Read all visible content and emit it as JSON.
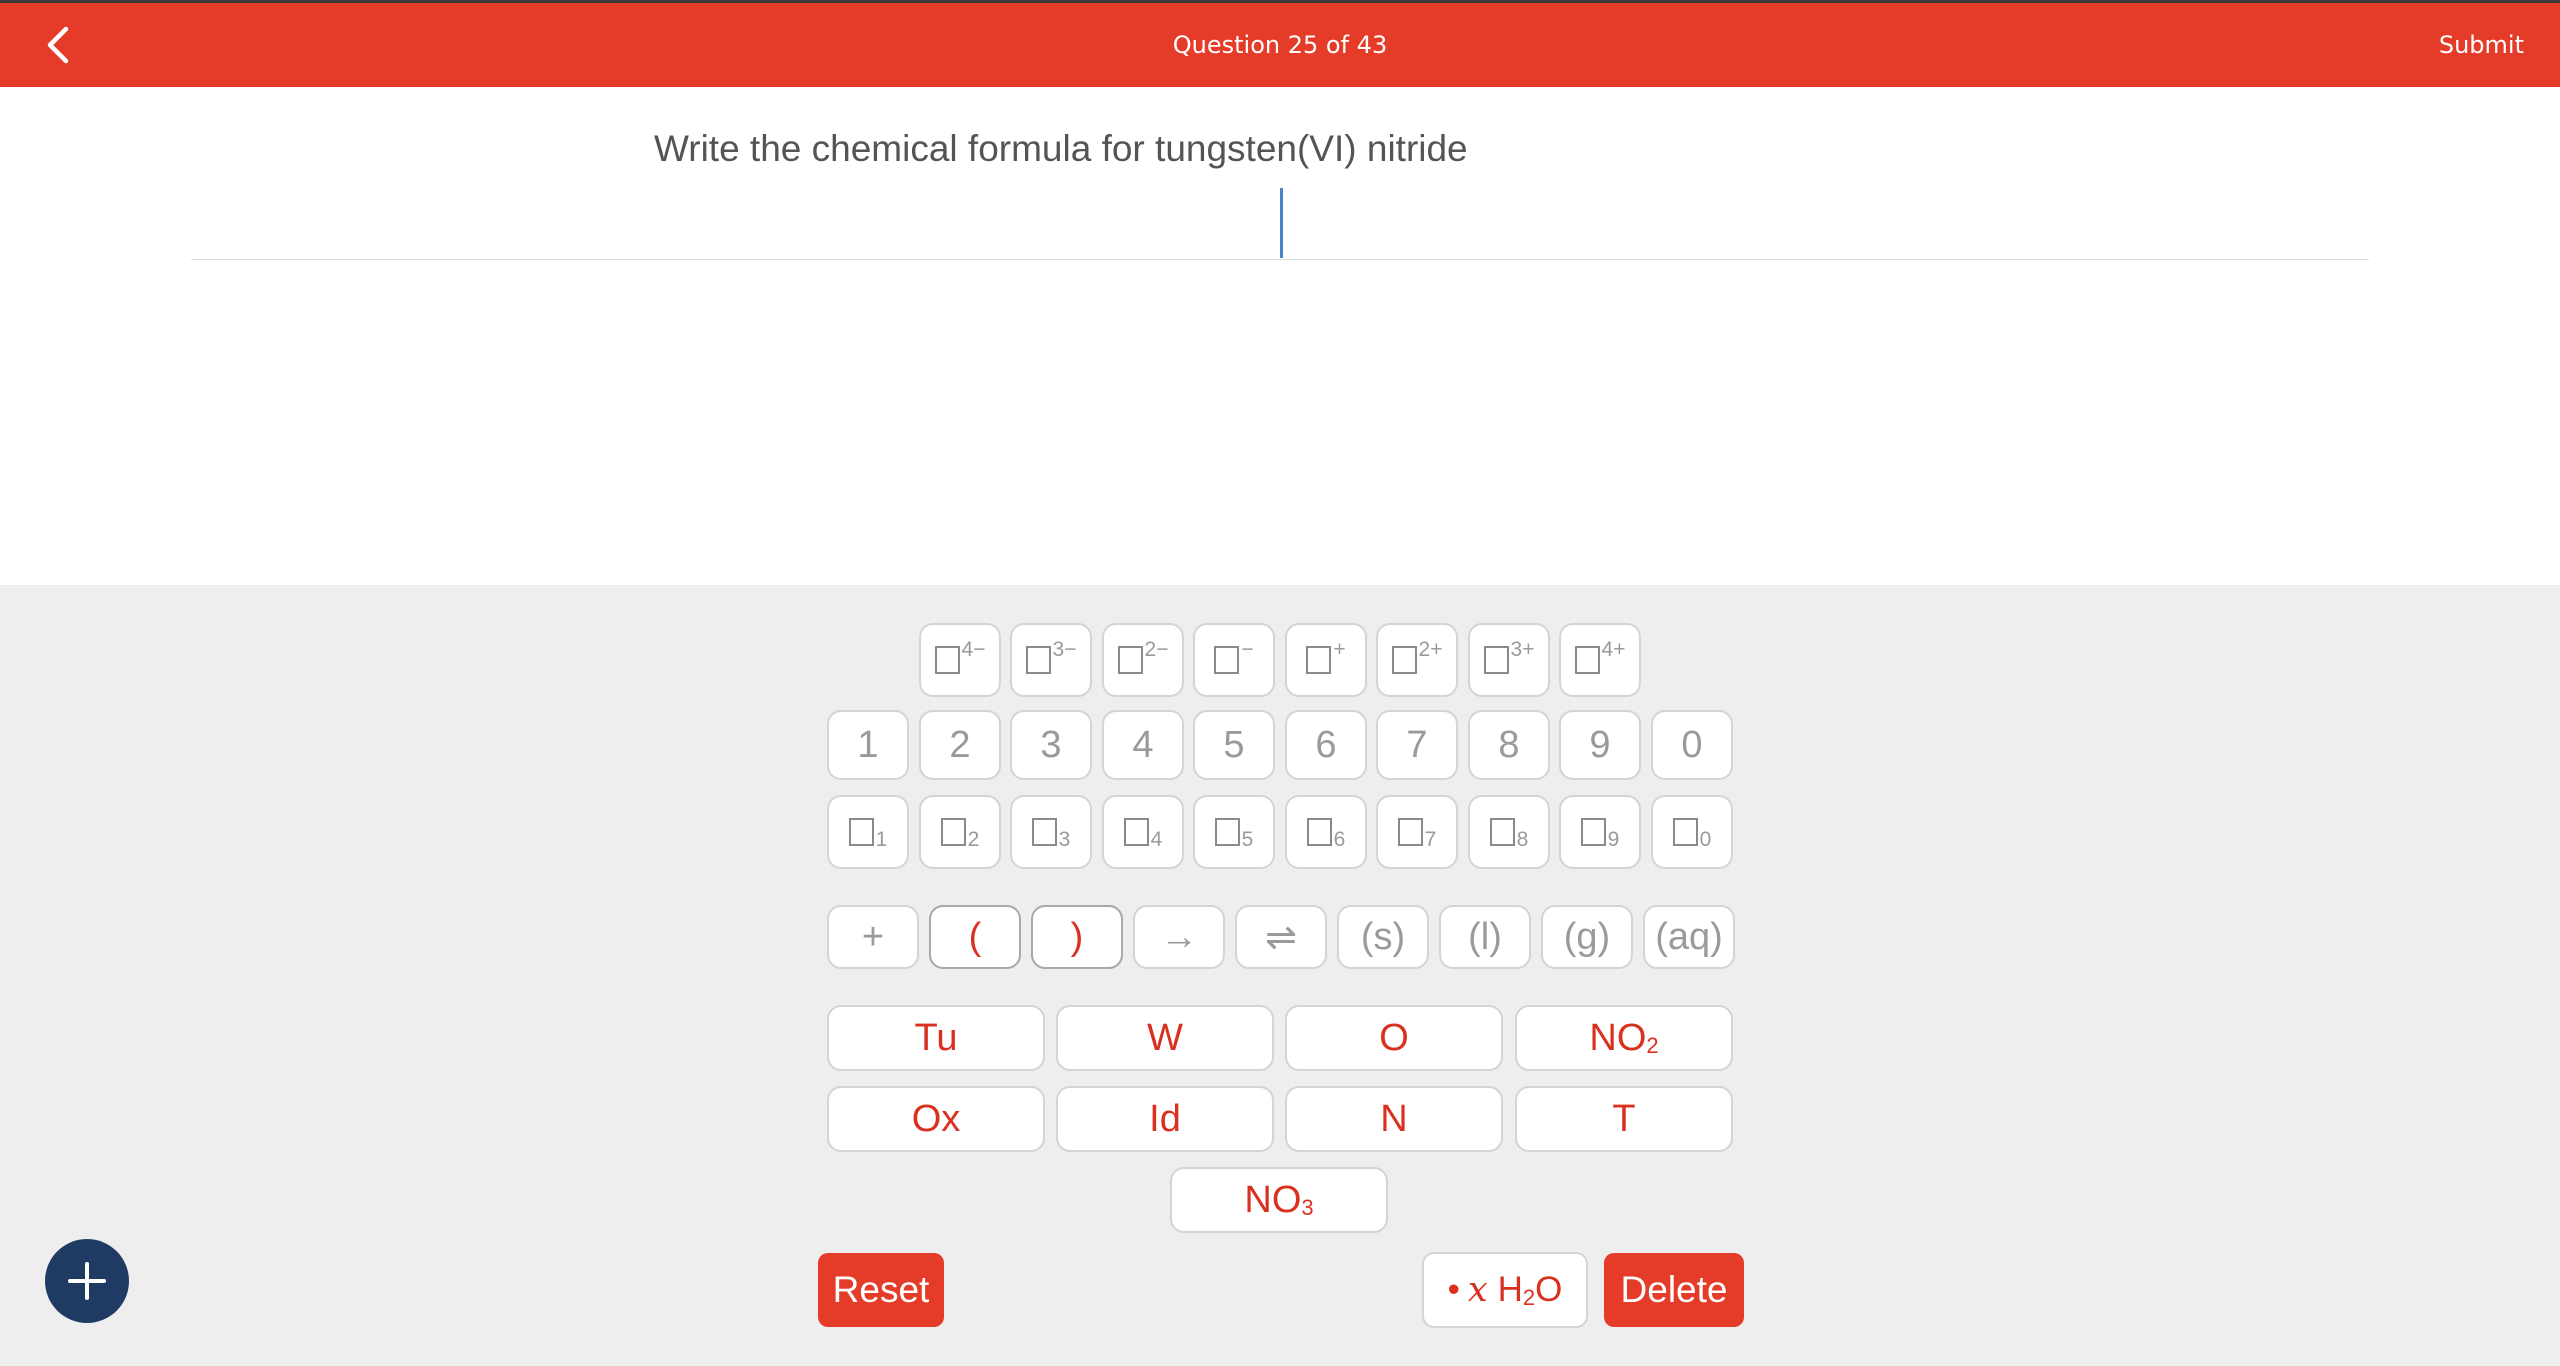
{
  "header": {
    "title": "Question 25 of 43",
    "submit_label": "Submit"
  },
  "question": {
    "text": "Write the chemical formula for tungsten(VI) nitride"
  },
  "charge_keys": [
    "4−",
    "3−",
    "2−",
    "−",
    "+",
    "2+",
    "3+",
    "4+"
  ],
  "digit_keys": [
    "1",
    "2",
    "3",
    "4",
    "5",
    "6",
    "7",
    "8",
    "9",
    "0"
  ],
  "subscript_keys": [
    "1",
    "2",
    "3",
    "4",
    "5",
    "6",
    "7",
    "8",
    "9",
    "0"
  ],
  "symbol_keys": [
    "+",
    "(",
    ")",
    "→",
    "⇌",
    "(s)",
    "(l)",
    "(g)",
    "(aq)"
  ],
  "element_keys": {
    "row1": [
      "Tu",
      "W",
      "O"
    ],
    "no2": {
      "base": "NO",
      "sub": "2"
    },
    "row2": [
      "Ox",
      "Id",
      "N",
      "T"
    ],
    "no3": {
      "base": "NO",
      "sub": "3"
    }
  },
  "actions": {
    "reset_label": "Reset",
    "delete_label": "Delete",
    "water": {
      "dot": "•",
      "x": "x",
      "h": "H",
      "sub": "2",
      "o": "O"
    }
  },
  "colors": {
    "accent": "#e53b29",
    "fab": "#1f3b63",
    "cursor": "#4a86c5",
    "keypad_bg": "#eeeeee"
  }
}
